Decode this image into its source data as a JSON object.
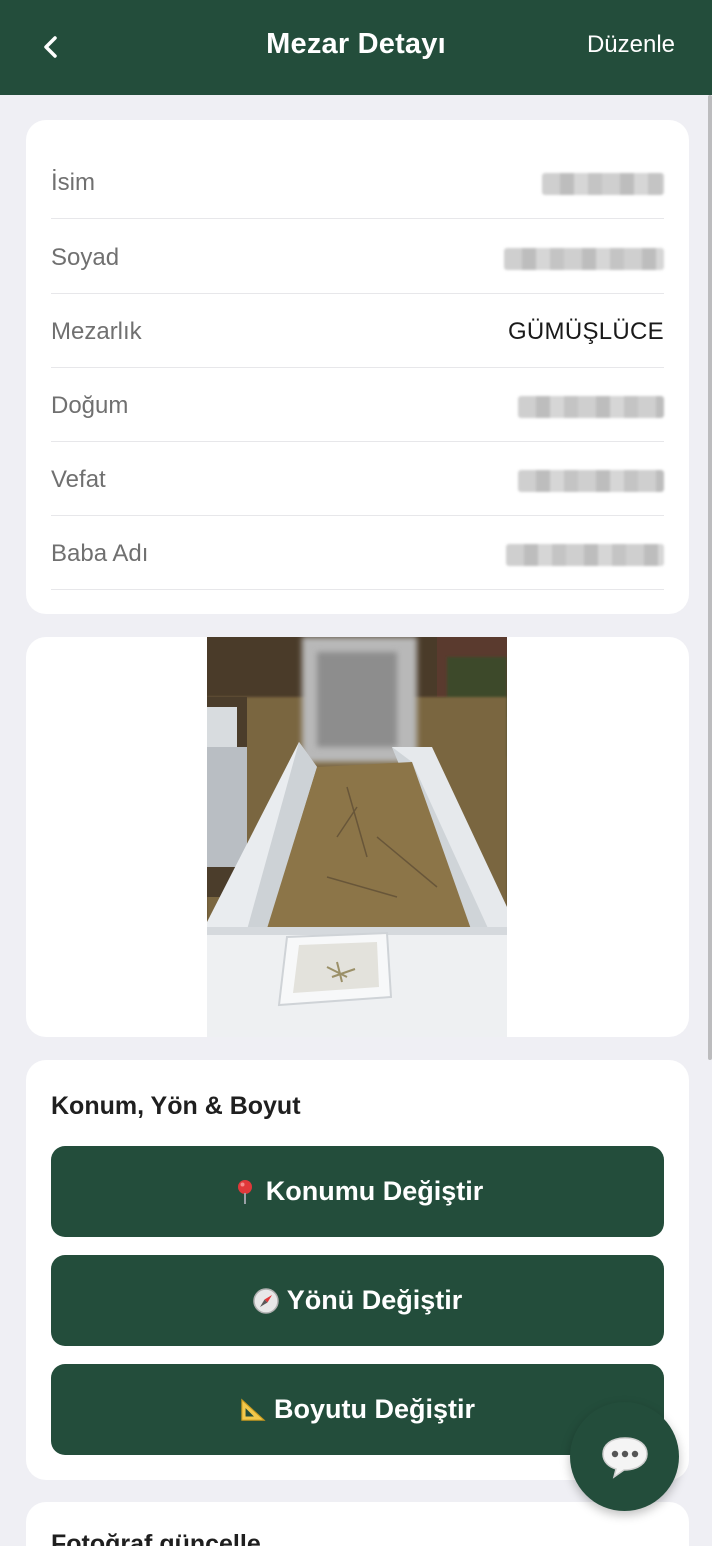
{
  "header": {
    "title": "Mezar Detayı",
    "edit_label": "Düzenle",
    "back_icon": "chevron-left-icon"
  },
  "info": {
    "rows": [
      {
        "label": "İsim",
        "value": "",
        "redacted": true
      },
      {
        "label": "Soyad",
        "value": "",
        "redacted": true
      },
      {
        "label": "Mezarlık",
        "value": "GÜMÜŞLÜCE",
        "redacted": false
      },
      {
        "label": "Doğum",
        "value": "",
        "redacted": true
      },
      {
        "label": "Vefat",
        "value": "",
        "redacted": true
      },
      {
        "label": "Baba Adı",
        "value": "",
        "redacted": true
      }
    ]
  },
  "actions": {
    "title": "Konum, Yön & Boyut",
    "location_label": "Konumu Değiştir",
    "location_icon": "pin-icon",
    "direction_label": "Yönü Değiştir",
    "direction_icon": "compass-icon",
    "size_label": "Boyutu Değiştir",
    "size_icon": "triangle-ruler-icon"
  },
  "photo_section": {
    "title": "Fotoğraf güncelle"
  },
  "colors": {
    "primary": "#234d3b",
    "background": "#efeff4",
    "card": "#ffffff"
  }
}
